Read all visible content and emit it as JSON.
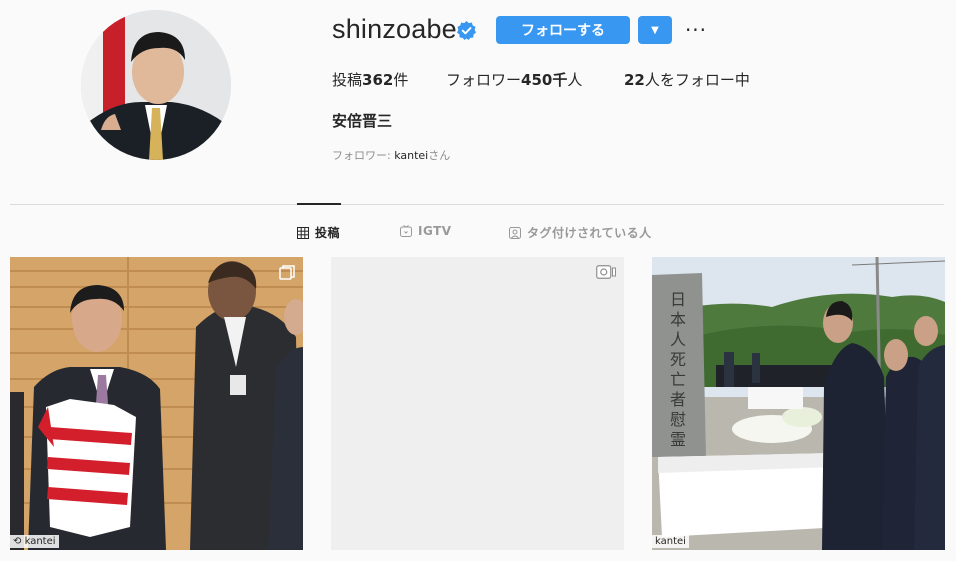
{
  "profile": {
    "username": "shinzoabe",
    "follow_label": "フォローする",
    "stats": {
      "posts_label": "投稿",
      "posts_count": "362",
      "posts_unit": "件",
      "followers_label": "フォロワー",
      "followers_count": "450千",
      "followers_unit": "人",
      "following_count": "22",
      "following_label": "人をフォロー中"
    },
    "full_name": "安倍晋三",
    "followed_by_prefix": "フォロワー: ",
    "followed_by_account": "kantei",
    "followed_by_suffix": "さん"
  },
  "tabs": [
    {
      "label": "投稿",
      "icon": "grid-icon",
      "active": true
    },
    {
      "label": "IGTV",
      "icon": "igtv-icon",
      "active": false
    },
    {
      "label": "タグ付けされている人",
      "icon": "tagged-icon",
      "active": false
    }
  ],
  "posts": [
    {
      "type": "multi-photo",
      "credit": "kantei",
      "icon": "carousel-icon"
    },
    {
      "type": "video",
      "credit": "",
      "icon": "igtv-post-icon"
    },
    {
      "type": "photo",
      "credit": "kantei",
      "icon": ""
    }
  ],
  "colors": {
    "accent": "#3897f0",
    "text": "#262626",
    "muted": "#8e8e8e",
    "background": "#fafafa",
    "divider": "#dbdbdb"
  }
}
